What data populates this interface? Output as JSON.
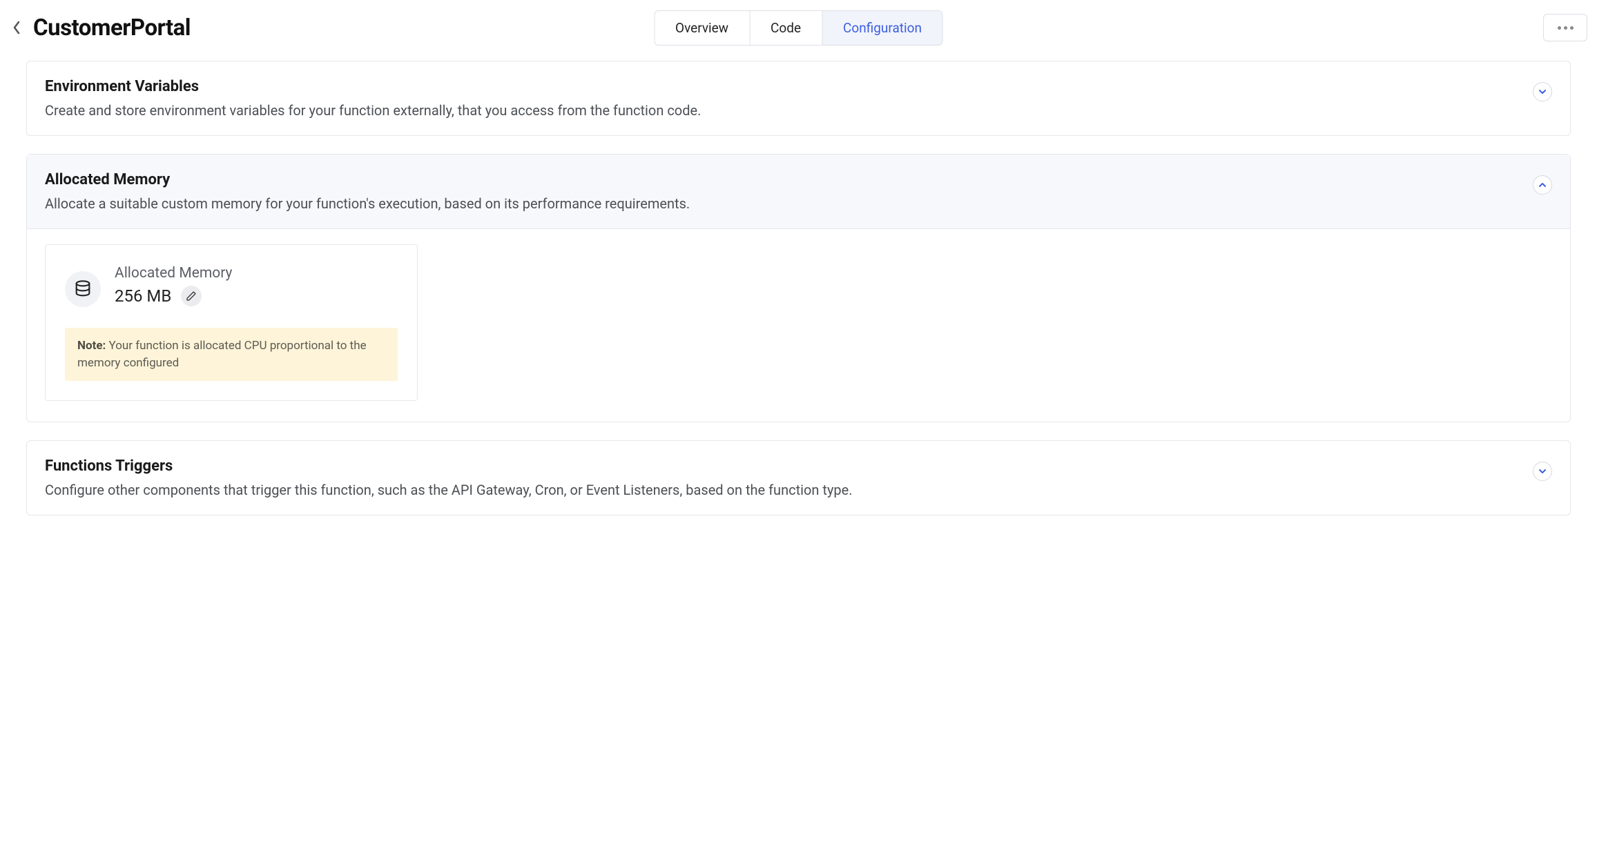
{
  "header": {
    "title": "CustomerPortal",
    "tabs": [
      {
        "label": "Overview",
        "active": false
      },
      {
        "label": "Code",
        "active": false
      },
      {
        "label": "Configuration",
        "active": true
      }
    ]
  },
  "panels": {
    "env": {
      "title": "Environment Variables",
      "desc": "Create and store environment variables for your function externally, that you access from the function code.",
      "expanded": false
    },
    "memory": {
      "title": "Allocated Memory",
      "desc": "Allocate a suitable custom memory for your function's execution, based on its performance requirements.",
      "expanded": true,
      "card": {
        "label": "Allocated Memory",
        "value": "256 MB",
        "note_label": "Note:",
        "note_text": " Your function is allocated CPU proportional to the memory configured"
      }
    },
    "triggers": {
      "title": "Functions Triggers",
      "desc": "Configure other components that trigger this function, such as the API Gateway, Cron, or Event Listeners, based on the function type.",
      "expanded": false
    }
  }
}
